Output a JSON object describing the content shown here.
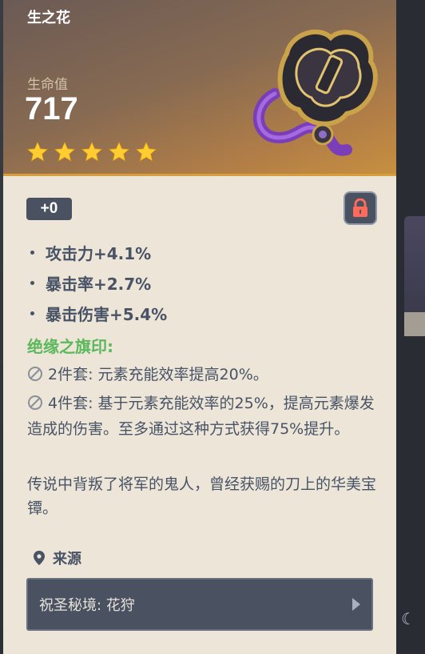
{
  "artifact": {
    "piece_name": "生之花",
    "main_stat_label": "生命值",
    "main_stat_value": "717",
    "rarity": 5,
    "level": "+0",
    "locked": true
  },
  "substats": [
    "攻击力+4.1%",
    "暴击率+2.7%",
    "暴击伤害+5.4%"
  ],
  "set": {
    "name": "绝缘之旗印:",
    "effect_2": "2件套: 元素充能效率提高20%。",
    "effect_4": "4件套: 基于元素充能效率的25%，提高元素爆发造成的伤害。至多通过这种方式获得75%提升。"
  },
  "lore": "传说中背叛了将军的鬼人，曾经获赐的刀上的华美宝镡。",
  "source": {
    "title": "来源",
    "item": "祝圣秘境: 花狩"
  },
  "colors": {
    "card_bg": "#ece5d8",
    "header_gold": "#c7903f",
    "set_green": "#5cb85c",
    "text_slate": "#495366",
    "star": "#ffcc32"
  }
}
